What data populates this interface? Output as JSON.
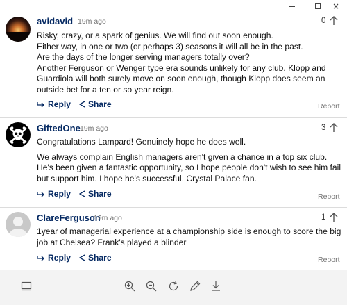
{
  "window": {
    "minimize_label": "minimize",
    "maximize_label": "maximize",
    "close_label": "×"
  },
  "comments": [
    {
      "author": "avidavid",
      "time": "19m ago",
      "votes": "0",
      "paragraphs": [
        "Risky, crazy, or a spark of genius. We will find out soon enough.",
        "Either way, in one or two (or perhaps 3) seasons it will all be in the past.",
        "Are the days of the longer serving managers totally over?",
        "Another Ferguson or Wenger type era sounds unlikely for any club. Klopp and Guardiola will both surely move on soon enough, though Klopp does seem an outside bet for a ten or so year reign."
      ],
      "reply_label": "Reply",
      "share_label": "Share",
      "report_label": "Report"
    },
    {
      "author": "GiftedOne",
      "time": "19m ago",
      "votes": "3",
      "paragraphs": [
        "Congratulations Lampard! Genuinely hope he does well.",
        "We always complain English managers aren't given a chance in a top six club. He's been given a fantastic opportunity, so I hope people don't wish to see him fail but support him. I hope he's successful. Crystal Palace fan."
      ],
      "reply_label": "Reply",
      "share_label": "Share",
      "report_label": "Report"
    },
    {
      "author": "ClareFerguson",
      "time": "19m ago",
      "votes": "1",
      "paragraphs": [
        "1year of managerial experience at a championship side is enough to score the big job at Chelsea? Frank's played a blinder"
      ],
      "reply_label": "Reply",
      "share_label": "Share",
      "report_label": "Report"
    }
  ],
  "toolbar": {
    "icons": [
      "reading-view-icon",
      "zoom-in-icon",
      "zoom-out-icon",
      "refresh-icon",
      "pen-icon",
      "download-icon"
    ]
  }
}
